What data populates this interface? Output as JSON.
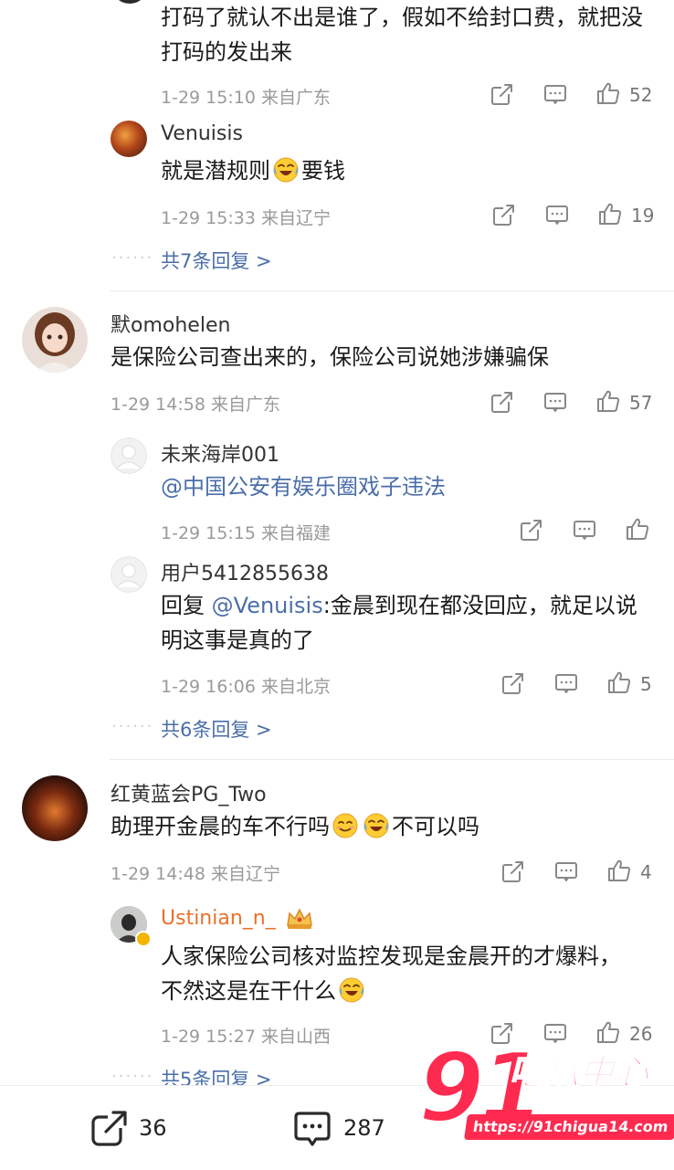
{
  "thread1": {
    "text": "打码了就认不出是谁了，假如不给封口费，就把没打码的发出来",
    "meta": "1-29 15:10 来自广东",
    "likes": "52",
    "reply": {
      "name": "Venuisis",
      "text": "就是潜规则",
      "text_after": "要钱",
      "meta": "1-29 15:33 来自辽宁",
      "likes": "19"
    },
    "more": "共7条回复 >"
  },
  "thread2": {
    "name": "默omohelen",
    "text": "是保险公司查出来的，保险公司说她涉嫌骗保",
    "meta": "1-29 14:58 来自广东",
    "likes": "57",
    "reply1": {
      "name": "未来海岸001",
      "text": "@中国公安有娱乐圈戏子违法",
      "meta": "1-29 15:15 来自福建"
    },
    "reply2": {
      "name": "用户5412855638",
      "prefix": "回复 ",
      "mention": "@Venuisis",
      "text": ":金晨到现在都没回应，就足以说明这事是真的了",
      "meta": "1-29 16:06 来自北京",
      "likes": "5"
    },
    "more": "共6条回复 >"
  },
  "thread3": {
    "name": "红黄蓝会PG_Two",
    "text": "助理开金晨的车不行吗",
    "text_after": "不可以吗",
    "meta": "1-29 14:48 来自辽宁",
    "likes": "4",
    "reply": {
      "name": "Ustinian_n_",
      "text": "人家保险公司核对监控发现是金晨开的才爆料，不然这是在干什么",
      "meta": "1-29 15:27 来自山西",
      "likes": "26"
    },
    "more": "共5条回复 >"
  },
  "bottom_bar": {
    "share_count": "36",
    "comment_count": "287"
  },
  "watermark": {
    "brand_number": "91",
    "brand_text": "吃瓜中心",
    "url": "https://91chigua14.com"
  },
  "icons": [
    "share-icon",
    "comment-icon",
    "like-icon",
    "laugh-cry-emoji",
    "smile-emoji",
    "crown-badge",
    "verified-badge"
  ],
  "colors": {
    "link": "#4a6ea8",
    "orange_name": "#e8722b",
    "meta": "#9a9a9a",
    "watermark_red": "#ff2a4f"
  }
}
